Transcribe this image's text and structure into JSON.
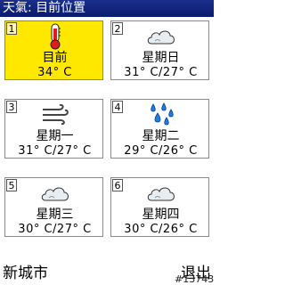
{
  "header": {
    "title": "天氣: 目前位置"
  },
  "tiles": [
    {
      "num": "1",
      "day": "目前",
      "temp": "34° C",
      "icon": "thermometer-icon",
      "selected": true
    },
    {
      "num": "2",
      "day": "星期日",
      "temp": "31° C/27° C",
      "icon": "cloudy-icon"
    },
    {
      "num": "3",
      "day": "星期一",
      "temp": "31° C/27° C",
      "icon": "windy-icon"
    },
    {
      "num": "4",
      "day": "星期二",
      "temp": "29° C/26° C",
      "icon": "rain-icon"
    },
    {
      "num": "5",
      "day": "星期三",
      "temp": "30° C/27° C",
      "icon": "cloudy-icon"
    },
    {
      "num": "6",
      "day": "星期四",
      "temp": "30° C/26° C",
      "icon": "cloudy-icon"
    }
  ],
  "footer": {
    "left_label": "新城市",
    "right_label": "退出",
    "watermark": "#13743"
  },
  "colors": {
    "title_bg": "#0a1c6e",
    "selected_bg": "#ffe800",
    "thermometer_red": "#e21b1b",
    "rain_blue": "#1e7de6"
  }
}
